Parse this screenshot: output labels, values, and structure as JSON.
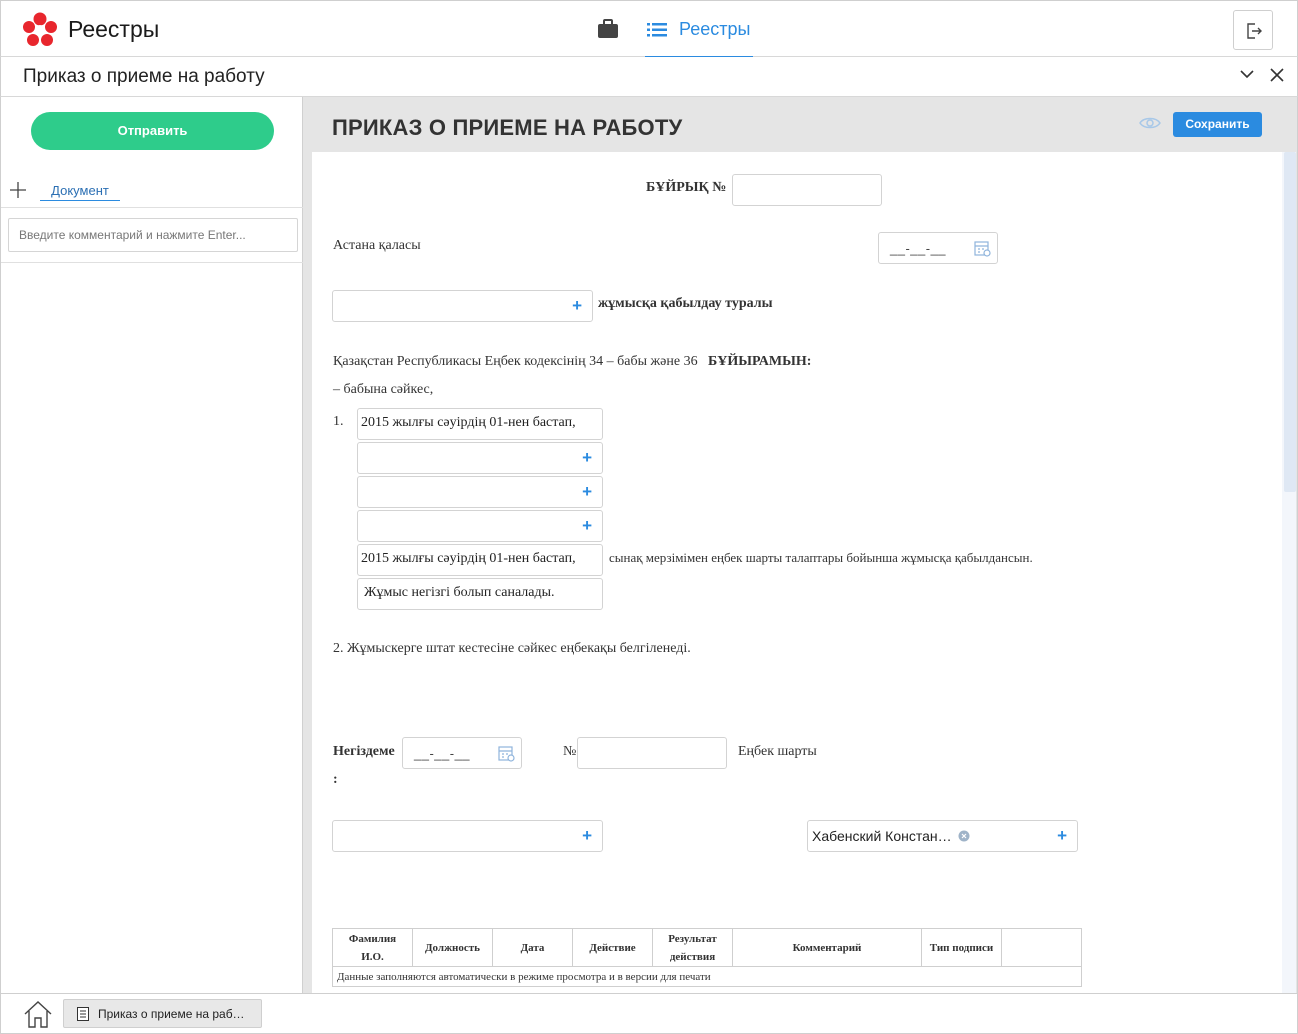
{
  "header": {
    "app_title": "Реестры",
    "nav_tab": "Реестры"
  },
  "subheader": {
    "title": "Приказ о приеме на работу"
  },
  "sidebar": {
    "send_button": "Отправить",
    "doc_tab": "Документ",
    "comment_placeholder": "Введите комментарий и нажмите Enter..."
  },
  "document": {
    "heading": "ПРИКАЗ О ПРИЕМЕ НА РАБОТУ",
    "save_button": "Сохранить",
    "order_no_label": "БҰЙРЫҚ №",
    "city": "Астана қаласы",
    "date_placeholder": "__-__-__",
    "hiring_label": "жұмысқа қабылдау туралы",
    "law_text": "Қазақстан Республикасы Еңбек кодексінің 34 – бабы және 36",
    "order_word": "БҰЙЫРАМЫН:",
    "law_text_2": "– бабына сәйкес,",
    "item1_num": "1.",
    "start_date_text": "2015 жылғы сәуірдің 01-нен  бастап,",
    "start_date_text_2": "2015 жылғы сәуірдің 01-нен  бастап,",
    "probation_text": "сынақ мерзімімен еңбек шарты талаптары бойынша жұмысқа қабылдансын.",
    "main_work_text": "Жұмыс негізгі болып саналады.",
    "item2_text": "2. Жұмыскерге штат кестесіне сәйкес еңбекақы белгіленеді.",
    "basis_label": "Негiздеме",
    "basis_colon": ":",
    "basis_date_placeholder": "__-__-__",
    "no_sign": "№",
    "contract_label": "Еңбек шарты",
    "signer_name": "Хабенский Констан…"
  },
  "signature_table": {
    "headers": [
      "Фамилия И.О.",
      "Должность",
      "Дата",
      "Действие",
      "Результат действия",
      "Комментарий",
      "Тип подписи",
      ""
    ],
    "note": "Данные заполняются автоматически в режиме просмотра и в версии для печати"
  },
  "taskbar": {
    "item_label": "Приказ о приеме на раб…"
  },
  "colors": {
    "accent": "#2b8be0",
    "send_green": "#2ecc8b",
    "logo_red": "#e8262d"
  }
}
